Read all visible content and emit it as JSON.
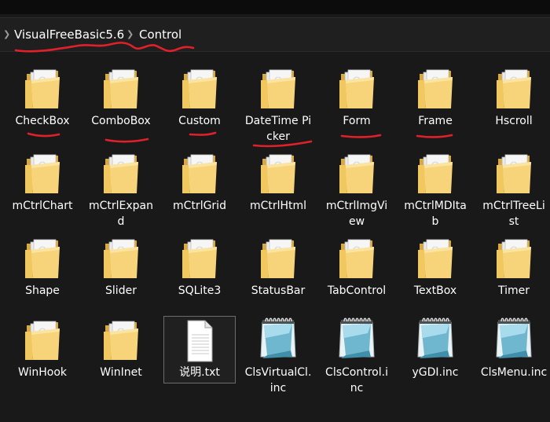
{
  "breadcrumb": {
    "chevron": "chevron-right-icon",
    "items": [
      "VisualFreeBasic5.6",
      "Control"
    ]
  },
  "colors": {
    "background": "#191919",
    "annotation": "#e0202a",
    "folder": "#f5cf6e",
    "text": "#ffffff"
  },
  "items": [
    {
      "label": "CheckBox",
      "icon": "folder-icon"
    },
    {
      "label": "ComboBox",
      "icon": "folder-icon"
    },
    {
      "label": "Custom",
      "icon": "folder-icon"
    },
    {
      "label": "DateTime Picker",
      "icon": "folder-icon"
    },
    {
      "label": "Form",
      "icon": "folder-icon"
    },
    {
      "label": "Frame",
      "icon": "folder-icon"
    },
    {
      "label": "Hscroll",
      "icon": "folder-icon"
    },
    {
      "label": "mCtrlChart",
      "icon": "folder-icon"
    },
    {
      "label": "mCtrlExpand",
      "icon": "folder-icon"
    },
    {
      "label": "mCtrlGrid",
      "icon": "folder-icon"
    },
    {
      "label": "mCtrlHtml",
      "icon": "folder-icon"
    },
    {
      "label": "mCtrlImgView",
      "icon": "folder-icon"
    },
    {
      "label": "mCtrlMDItab",
      "icon": "folder-icon"
    },
    {
      "label": "mCtrlTreeList",
      "icon": "folder-icon"
    },
    {
      "label": "Shape",
      "icon": "folder-icon"
    },
    {
      "label": "Slider",
      "icon": "folder-icon"
    },
    {
      "label": "SQLite3",
      "icon": "folder-icon"
    },
    {
      "label": "StatusBar",
      "icon": "folder-icon"
    },
    {
      "label": "TabControl",
      "icon": "folder-icon"
    },
    {
      "label": "TextBox",
      "icon": "folder-icon"
    },
    {
      "label": "Timer",
      "icon": "folder-icon"
    },
    {
      "label": "WinHook",
      "icon": "folder-icon"
    },
    {
      "label": "WinInet",
      "icon": "folder-icon"
    },
    {
      "label": "说明.txt",
      "icon": "text-file-icon"
    },
    {
      "label": "ClsVirtualCl.inc",
      "icon": "notepad-file-icon"
    },
    {
      "label": "ClsControl.inc",
      "icon": "notepad-file-icon"
    },
    {
      "label": "yGDI.inc",
      "icon": "notepad-file-icon"
    },
    {
      "label": "ClsMenu.inc",
      "icon": "notepad-file-icon"
    }
  ]
}
